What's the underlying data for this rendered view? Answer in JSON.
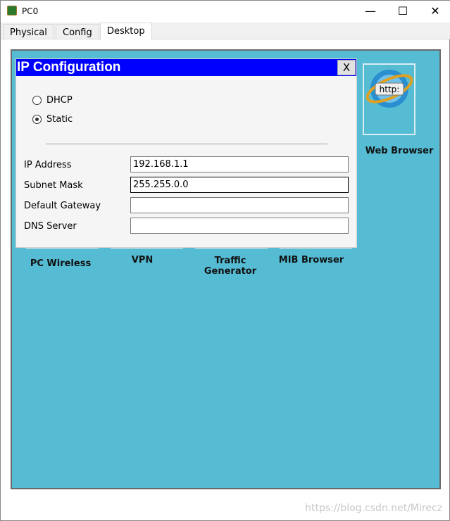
{
  "window": {
    "title": "PC0",
    "minimize": "—",
    "maximize": "☐",
    "close": "✕"
  },
  "tabs": [
    {
      "label": "Physical"
    },
    {
      "label": "Config"
    },
    {
      "label": "Desktop"
    }
  ],
  "dialog": {
    "title": "IP Configuration",
    "close": "X",
    "modes": [
      {
        "label": "DHCP",
        "selected": false
      },
      {
        "label": "Static",
        "selected": true
      }
    ],
    "fields": [
      {
        "label": "IP Address",
        "value": "192.168.1.1"
      },
      {
        "label": "Subnet Mask",
        "value": "255.255.0.0"
      },
      {
        "label": "Default Gateway",
        "value": ""
      },
      {
        "label": "DNS Server",
        "value": ""
      }
    ]
  },
  "apps": {
    "web_browser": "Web Browser",
    "web_icon_text": "http:",
    "pc_wireless": "PC Wireless",
    "vpn": "VPN",
    "traffic": "Traffic Generator",
    "mib": "MIB Browser"
  },
  "watermark": "https://blog.csdn.net/Mirecz"
}
